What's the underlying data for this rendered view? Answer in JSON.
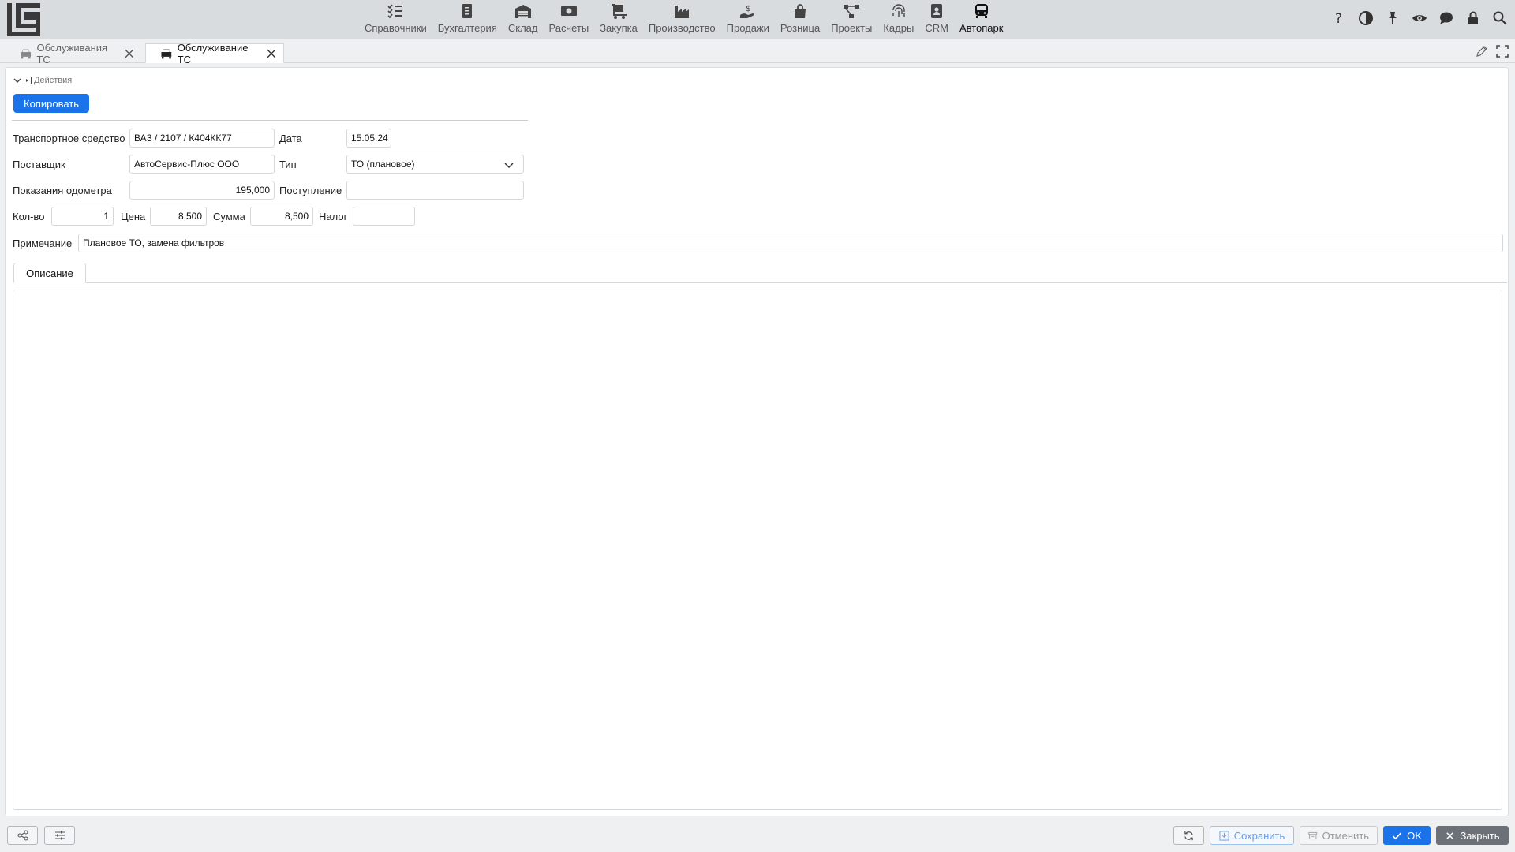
{
  "nav": {
    "items": [
      {
        "label": "Справочники",
        "icon": "list-check-icon"
      },
      {
        "label": "Бухгалтерия",
        "icon": "ledger-icon"
      },
      {
        "label": "Склад",
        "icon": "warehouse-icon"
      },
      {
        "label": "Расчеты",
        "icon": "money-icon"
      },
      {
        "label": "Закупка",
        "icon": "dolly-icon"
      },
      {
        "label": "Производство",
        "icon": "factory-icon"
      },
      {
        "label": "Продажи",
        "icon": "hand-dollar-icon"
      },
      {
        "label": "Розница",
        "icon": "shopping-bag-icon"
      },
      {
        "label": "Проекты",
        "icon": "project-diagram-icon"
      },
      {
        "label": "Кадры",
        "icon": "fingerprint-icon"
      },
      {
        "label": "CRM",
        "icon": "contact-card-icon"
      },
      {
        "label": "Автопарк",
        "icon": "bus-icon",
        "active": true
      }
    ]
  },
  "tabs": [
    {
      "label": "Обслуживания ТС",
      "active": false
    },
    {
      "label": "Обслуживание ТС",
      "active": true
    }
  ],
  "actions": {
    "title": "Действия",
    "copy_label": "Копировать"
  },
  "form": {
    "vehicle_label": "Транспортное средство",
    "vehicle_value": "ВАЗ / 2107 / К404КК77",
    "date_label": "Дата",
    "date_value": "15.05.24",
    "supplier_label": "Поставщик",
    "supplier_value": "АвтоСервис-Плюс ООО",
    "type_label": "Тип",
    "type_value": "ТО (плановое)",
    "odometer_label": "Показания одометра",
    "odometer_value": "195,000",
    "receipt_label": "Поступление",
    "receipt_value": "",
    "qty_label": "Кол-во",
    "qty_value": "1",
    "price_label": "Цена",
    "price_value": "8,500",
    "sum_label": "Сумма",
    "sum_value": "8,500",
    "tax_label": "Налог",
    "tax_value": "",
    "note_label": "Примечание",
    "note_value": "Плановое ТО, замена фильтров"
  },
  "subtabs": {
    "description": "Описание"
  },
  "footer": {
    "save": "Сохранить",
    "cancel": "Отменить",
    "ok": "OK",
    "close": "Закрыть"
  },
  "colors": {
    "accent": "#1a73e8",
    "topbar": "#d9dcdf",
    "close_button": "#6c7177"
  }
}
